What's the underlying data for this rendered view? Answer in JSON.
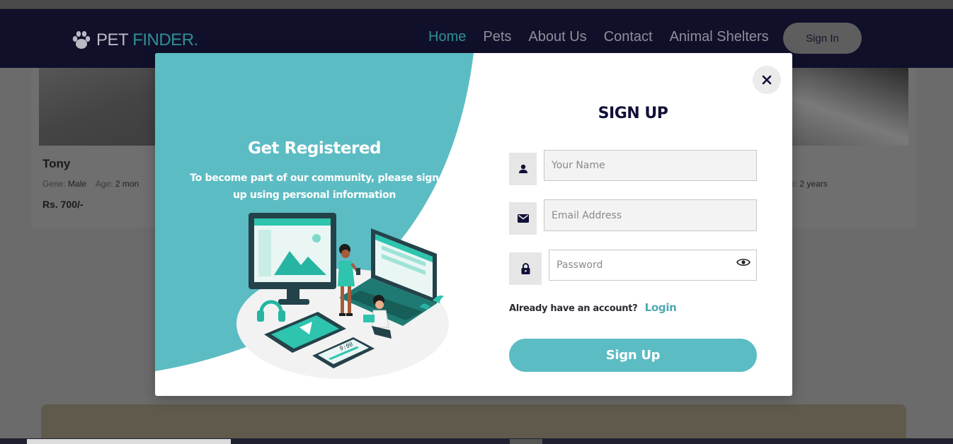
{
  "nav": {
    "brand_pet": "PET",
    "brand_finder": "FINDER.",
    "links": [
      "Home",
      "Pets",
      "About Us",
      "Contact",
      "Animal Shelters"
    ],
    "signin_label": "Sign In"
  },
  "cards": [
    {
      "name": "Tony",
      "gender_label": "Gene:",
      "gender": "Male",
      "age_label": "Age:",
      "age": "2 mon",
      "price": "Rs. 700/-"
    },
    {
      "age_partial": "e:",
      "age": "2 years"
    }
  ],
  "modal": {
    "left_title": "Get Registered",
    "left_subtitle": "To become part of our community, please sign up using personal information",
    "form_title": "SIGN UP",
    "name_placeholder": "Your Name",
    "email_placeholder": "Email Address",
    "password_placeholder": "Password",
    "have_account_text": "Already have an account?",
    "login_link": "Login",
    "submit_label": "Sign Up",
    "illustration_time": "9:00"
  },
  "colors": {
    "teal": "#5cbcc3",
    "navy": "#101038",
    "dark_teal": "#1e7a72",
    "mid_teal": "#26b5a3"
  },
  "icons": [
    "paw-icon",
    "close-icon",
    "user-icon",
    "mail-icon",
    "lock-icon",
    "eye-icon"
  ]
}
